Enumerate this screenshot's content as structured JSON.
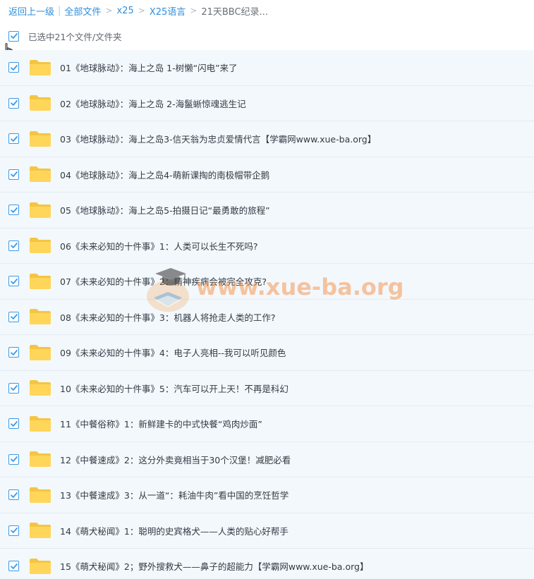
{
  "breadcrumb": {
    "back": "返回上一级",
    "all_files": "全部文件",
    "folder1": "x25",
    "folder2": "X25语言",
    "current": "21天BBC纪录..."
  },
  "selection": {
    "label": "已选中21个文件/文件夹"
  },
  "files": [
    "01《地球脉动》：海上之岛 1-树懒“闪电”来了",
    "02《地球脉动》：海上之岛 2-海鬣蜥惊魂逃生记",
    "03《地球脉动》：海上之岛3-信天翁为忠贞爱情代言【学霸网www.xue-ba.org】",
    "04《地球脉动》：海上之岛4-萌新课掏的南极帽带企鹅",
    "05《地球脉动》：海上之岛5-拍摄日记“最勇敢的旅程”",
    "06《未来必知的十件事》1：人类可以长生不死吗?",
    "07《未来必知的十件事》2：精神疾病会被完全攻克?",
    "08《未来必知的十件事》3：机器人将抢走人类的工作?",
    "09《未来必知的十件事》4：电子人亮相--我可以听见颜色",
    "10《未来必知的十件事》5：汽车可以开上天！不再是科幻",
    "11《中餐俗称》1：新鲜建卡的中式快餐“鸡肉炒面”",
    "12《中餐速成》2：这分外卖竟相当于30个汉堡！减肥必看",
    "13《中餐速成》3：从一道“：耗油牛肉”看中国的烹饪哲学",
    "14《萌犬秘闻》1：聪明的史宾格犬——人类的贴心好帮手",
    "15《萌犬秘闻》2；野外搜救犬——鼻子的超能力【学霸网www.xue-ba.org】"
  ],
  "watermark": {
    "text": "www.xue-ba.org"
  },
  "colors": {
    "accent": "#2f8fdc",
    "row_bg": "#f3f8fd",
    "folder": "#ffd65a"
  },
  "icons": {
    "checkbox": "check-icon",
    "folder": "folder-icon",
    "cursor": "hand-pointer-icon",
    "watermark_logo": "graduation-cap-book-icon"
  }
}
